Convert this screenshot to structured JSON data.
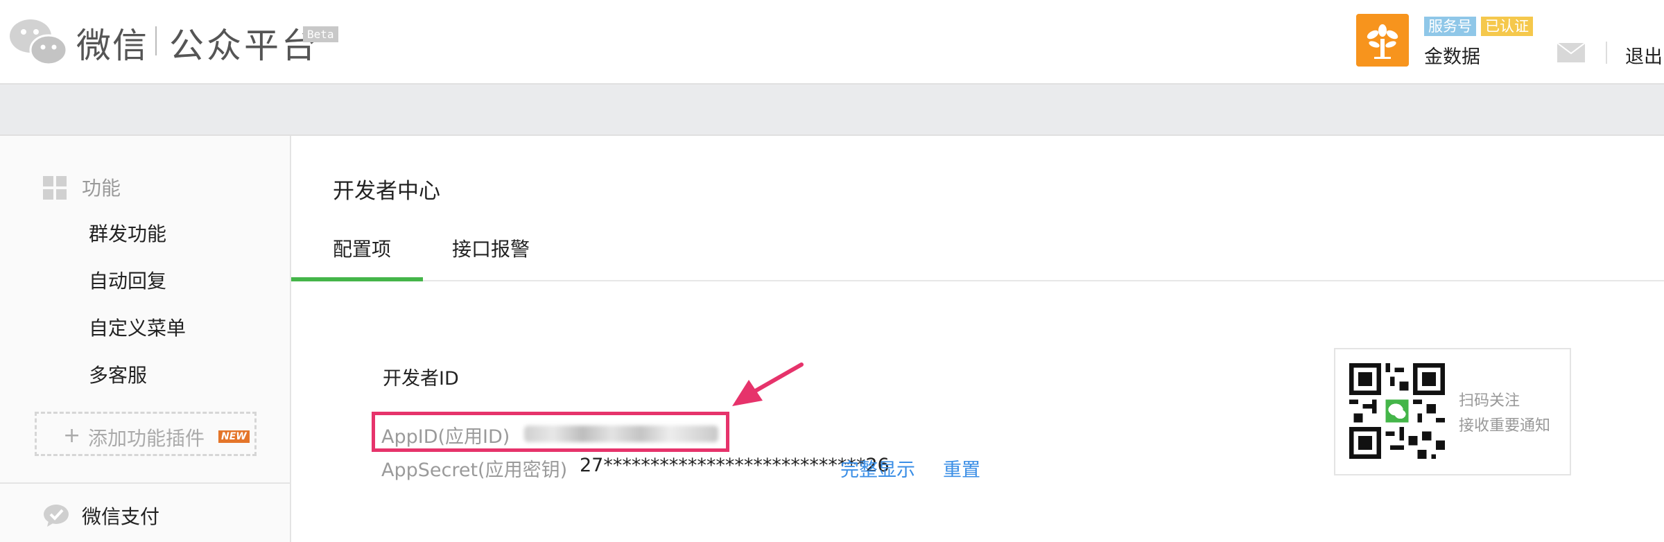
{
  "header": {
    "brand_name": "微信",
    "brand_sub": "公众平台",
    "beta": "Beta",
    "account": {
      "badge_service": "服务号",
      "badge_verified": "已认证",
      "name": "金数据"
    },
    "logout": "退出"
  },
  "sidebar": {
    "category_features": "功能",
    "items": [
      {
        "label": "群发功能"
      },
      {
        "label": "自动回复"
      },
      {
        "label": "自定义菜单"
      },
      {
        "label": "多客服"
      }
    ],
    "add_plugin": "添加功能插件",
    "new_badge": "NEW",
    "category_pay": "微信支付"
  },
  "main": {
    "title": "开发者中心",
    "tabs": [
      {
        "label": "配置项"
      },
      {
        "label": "接口报警"
      }
    ],
    "developer_id_label": "开发者ID",
    "appid_label": "AppID(应用ID)",
    "appsecret_label": "AppSecret(应用密钥)",
    "appsecret_value": "27****************************26",
    "show_full_link": "完整显示",
    "reset_link": "重置"
  },
  "qr_card": {
    "line1": "扫码关注",
    "line2": "接收重要通知"
  },
  "colors": {
    "accent_green": "#44b549",
    "link_blue": "#3a8ee6",
    "highlight_pink": "#e6336b",
    "avatar_orange": "#f7941d"
  }
}
